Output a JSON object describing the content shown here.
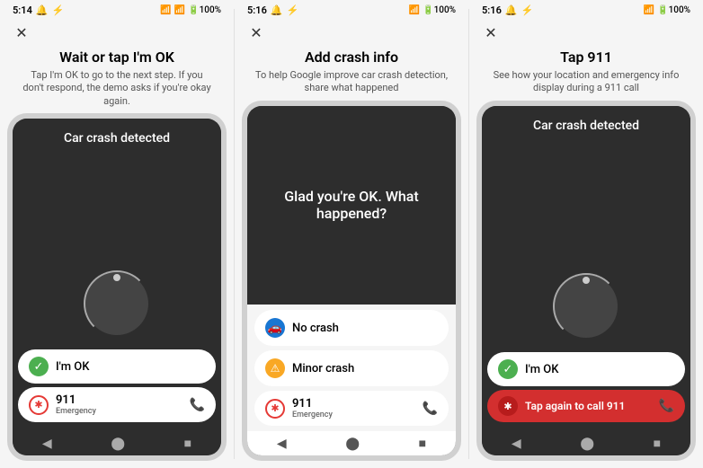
{
  "panels": [
    {
      "id": "panel-1",
      "statusTime": "5:14",
      "title": "Wait or tap I'm OK",
      "subtitle": "Tap I'm OK to go to the next step. If you don't respond, the demo asks if you're okay again.",
      "screen": {
        "crashText": "Car crash detected",
        "buttons": [
          {
            "type": "ok",
            "label": "I'm OK"
          },
          {
            "type": "911",
            "label": "911",
            "sub": "Emergency"
          }
        ]
      }
    },
    {
      "id": "panel-2",
      "statusTime": "5:16",
      "title": "Add crash info",
      "subtitle": "To help Google improve car crash detection, share what happened",
      "screen": {
        "question": "Glad you're OK. What happened?",
        "options": [
          {
            "type": "no-crash",
            "label": "No crash"
          },
          {
            "type": "minor-crash",
            "label": "Minor crash"
          }
        ],
        "buttons": [
          {
            "type": "911",
            "label": "911",
            "sub": "Emergency"
          }
        ]
      }
    },
    {
      "id": "panel-3",
      "statusTime": "5:16",
      "title": "Tap 911",
      "subtitle": "See how your location and emergency info display during a 911 call",
      "screen": {
        "crashText": "Car crash detected",
        "buttons": [
          {
            "type": "ok",
            "label": "I'm OK"
          },
          {
            "type": "911-red",
            "label": "Tap again to call 911"
          }
        ]
      }
    }
  ],
  "nav": {
    "back": "◀",
    "home": "⬤",
    "recents": "■"
  },
  "icons": {
    "close": "✕",
    "check": "✓",
    "xmark": "✕",
    "asterisk": "✱",
    "phone": "📞",
    "car": "🚗",
    "warning": "⚠"
  }
}
